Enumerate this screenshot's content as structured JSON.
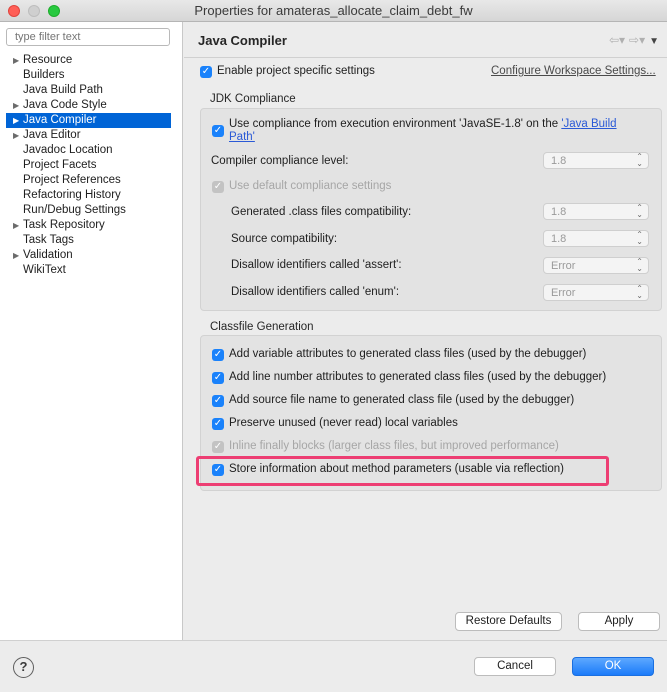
{
  "window": {
    "title": "Properties for amateras_allocate_claim_debt_fw"
  },
  "sidebar": {
    "filter_placeholder": "type filter text",
    "items": [
      {
        "label": "Resource",
        "expandable": true,
        "selected": false
      },
      {
        "label": "Builders",
        "expandable": false,
        "selected": false
      },
      {
        "label": "Java Build Path",
        "expandable": false,
        "selected": false
      },
      {
        "label": "Java Code Style",
        "expandable": true,
        "selected": false
      },
      {
        "label": "Java Compiler",
        "expandable": true,
        "selected": true
      },
      {
        "label": "Java Editor",
        "expandable": true,
        "selected": false
      },
      {
        "label": "Javadoc Location",
        "expandable": false,
        "selected": false
      },
      {
        "label": "Project Facets",
        "expandable": false,
        "selected": false
      },
      {
        "label": "Project References",
        "expandable": false,
        "selected": false
      },
      {
        "label": "Refactoring History",
        "expandable": false,
        "selected": false
      },
      {
        "label": "Run/Debug Settings",
        "expandable": false,
        "selected": false
      },
      {
        "label": "Task Repository",
        "expandable": true,
        "selected": false
      },
      {
        "label": "Task Tags",
        "expandable": false,
        "selected": false
      },
      {
        "label": "Validation",
        "expandable": true,
        "selected": false
      },
      {
        "label": "WikiText",
        "expandable": false,
        "selected": false
      }
    ]
  },
  "page": {
    "title": "Java Compiler",
    "enable_specific": "Enable project specific settings",
    "configure_workspace": "Configure Workspace Settings...",
    "jdk": {
      "title": "JDK Compliance",
      "use_compliance_prefix": "Use compliance from execution environment 'JavaSE-1.8' on the ",
      "use_compliance_link": "'Java Build",
      "use_compliance_link2": "Path'",
      "compliance_level_label": "Compiler compliance level:",
      "compliance_level_value": "1.8",
      "use_default": "Use default compliance settings",
      "generated_label": "Generated .class files compatibility:",
      "generated_value": "1.8",
      "source_label": "Source compatibility:",
      "source_value": "1.8",
      "assert_label": "Disallow identifiers called 'assert':",
      "assert_value": "Error",
      "enum_label": "Disallow identifiers called 'enum':",
      "enum_value": "Error"
    },
    "classfile": {
      "title": "Classfile Generation",
      "options": [
        {
          "label": "Add variable attributes to generated class files (used by the debugger)",
          "checked": true,
          "enabled": true
        },
        {
          "label": "Add line number attributes to generated class files (used by the debugger)",
          "checked": true,
          "enabled": true
        },
        {
          "label": "Add source file name to generated class file (used by the debugger)",
          "checked": true,
          "enabled": true
        },
        {
          "label": "Preserve unused (never read) local variables",
          "checked": true,
          "enabled": true
        },
        {
          "label": "Inline finally blocks (larger class files, but improved performance)",
          "checked": true,
          "enabled": false
        },
        {
          "label": "Store information about method parameters (usable via reflection)",
          "checked": true,
          "enabled": true
        }
      ]
    },
    "restore_defaults": "Restore Defaults",
    "apply": "Apply"
  },
  "footer": {
    "help": "?",
    "cancel": "Cancel",
    "ok": "OK"
  },
  "colors": {
    "accent": "#1a82fb",
    "highlight": "#ed3e73",
    "selection": "#0064d6"
  }
}
